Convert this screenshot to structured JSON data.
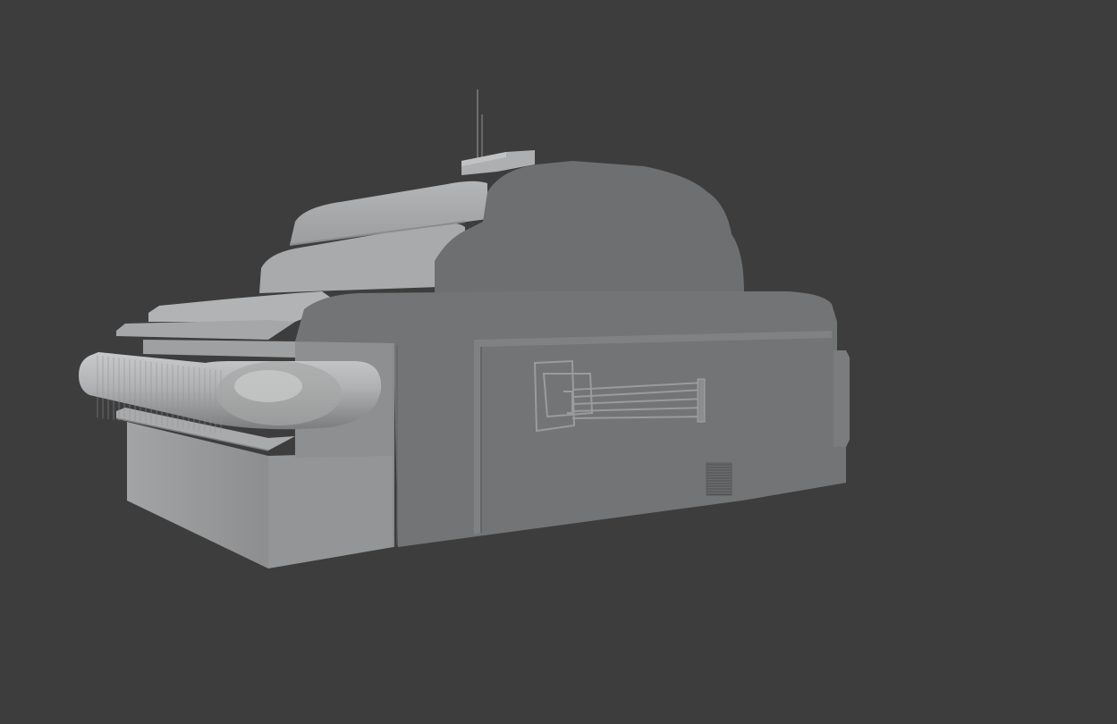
{
  "viewport": {
    "background_color": "#3d3d3d",
    "object": "grey-clay-render-scifi-vehicle"
  },
  "colors": {
    "dark_face": "#6e6f70",
    "mid_face": "#8a8b8c",
    "light_face": "#a8a9aa",
    "highlight": "#c2c3c4",
    "line": "#5a5b5c"
  }
}
